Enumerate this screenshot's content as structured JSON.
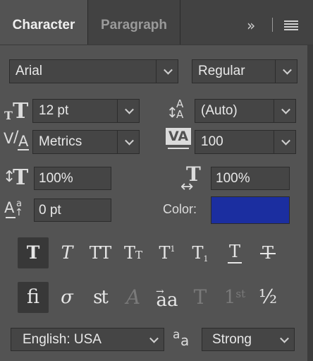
{
  "tabs": [
    {
      "label": "Character",
      "active": true
    },
    {
      "label": "Paragraph",
      "active": false
    }
  ],
  "header_icons": [
    "expand-icon",
    "panel-menu-icon"
  ],
  "font_family": "Arial",
  "font_style": "Regular",
  "font_size": "12 pt",
  "leading": "(Auto)",
  "kerning": "Metrics",
  "tracking": "100",
  "vertical_scale": "100%",
  "horizontal_scale": "100%",
  "baseline_shift": "0 pt",
  "color_label": "Color:",
  "color_value": "#1b2ea0",
  "style_buttons": [
    {
      "name": "faux-bold-button",
      "glyph": "T",
      "active": true
    },
    {
      "name": "faux-italic-button",
      "glyph": "T",
      "active": false
    },
    {
      "name": "all-caps-button",
      "glyph": "TT",
      "active": false
    },
    {
      "name": "small-caps-button",
      "glyph": "Tt",
      "active": false
    },
    {
      "name": "superscript-button",
      "glyph": "T¹",
      "active": false
    },
    {
      "name": "subscript-button",
      "glyph": "T₁",
      "active": false
    },
    {
      "name": "underline-button",
      "glyph": "T",
      "active": false
    },
    {
      "name": "strikethrough-button",
      "glyph": "T",
      "active": false
    }
  ],
  "opentype_buttons": [
    {
      "name": "standard-ligatures-button",
      "glyph": "fi",
      "active": true,
      "enabled": true
    },
    {
      "name": "contextual-alternates-button",
      "glyph": "σ",
      "active": false,
      "enabled": true
    },
    {
      "name": "discretionary-ligatures-button",
      "glyph": "st",
      "active": false,
      "enabled": true
    },
    {
      "name": "swash-button",
      "glyph": "A",
      "active": false,
      "enabled": false
    },
    {
      "name": "stylistic-alternates-button",
      "glyph": "aa",
      "active": false,
      "enabled": true
    },
    {
      "name": "titling-alternates-button",
      "glyph": "T",
      "active": false,
      "enabled": false
    },
    {
      "name": "ordinals-button",
      "glyph": "1st",
      "active": false,
      "enabled": false
    },
    {
      "name": "fractions-button",
      "glyph": "½",
      "active": false,
      "enabled": true
    }
  ],
  "language": "English: USA",
  "antialias_icon_text": "aa",
  "antialias": "Strong"
}
